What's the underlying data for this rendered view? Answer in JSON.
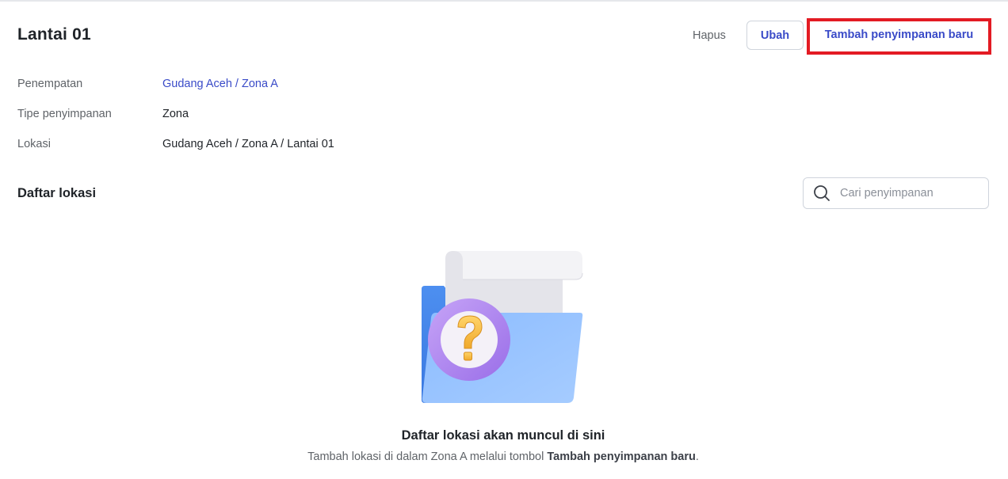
{
  "header": {
    "title": "Lantai 01",
    "actions": {
      "delete_label": "Hapus",
      "edit_label": "Ubah",
      "add_label": "Tambah penyimpanan baru"
    },
    "highlight_color": "#e31b23",
    "accent_color": "#3a4bc8"
  },
  "details": [
    {
      "label": "Penempatan",
      "value": "Gudang Aceh / Zona A",
      "is_link": true
    },
    {
      "label": "Tipe penyimpanan",
      "value": "Zona",
      "is_link": false
    },
    {
      "label": "Lokasi",
      "value": "Gudang Aceh / Zona A / Lantai 01",
      "is_link": false
    }
  ],
  "section": {
    "title": "Daftar lokasi",
    "search": {
      "placeholder": "Cari penyimpanan",
      "icon": "search-icon"
    }
  },
  "empty_state": {
    "illustration_icon": "folder-question-icon",
    "title": "Daftar lokasi akan muncul di sini",
    "desc_prefix": "Tambah lokasi di dalam Zona A melalui tombol ",
    "desc_bold": "Tambah penyimpanan baru",
    "desc_suffix": "."
  }
}
